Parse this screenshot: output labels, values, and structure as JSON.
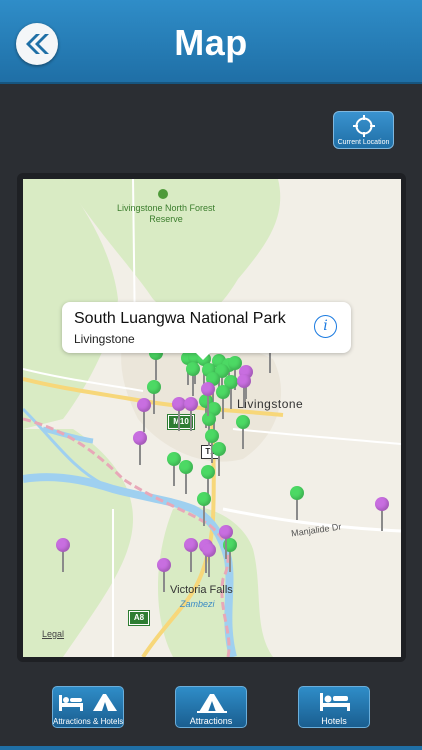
{
  "header": {
    "title": "Map",
    "back_icon": "double-chevron-left-icon"
  },
  "current_location": {
    "label": "Current Location",
    "icon": "crosshair-icon"
  },
  "map": {
    "place_labels": {
      "forest_reserve": "Livingstone North Forest Reserve",
      "town": "Livingstone",
      "victoria_falls": "Victoria Falls",
      "zambezi": "Zambezi",
      "road": "Manjalide Dr",
      "legal": "Legal"
    },
    "road_shields": {
      "m10": "M10",
      "t1": "T1",
      "a8": "A8"
    },
    "pin_colors": {
      "attraction": "#4cd964",
      "hotel": "#c86ee0"
    },
    "callout": {
      "title": "South Luangwa National Park",
      "subtitle": "Livingstone",
      "info_icon": "info-icon"
    }
  },
  "tabs": [
    {
      "label": "Attractions & Hotels",
      "icon": "bed-tent-icon"
    },
    {
      "label": "Attractions",
      "icon": "tent-icon"
    },
    {
      "label": "Hotels",
      "icon": "bed-icon"
    }
  ]
}
